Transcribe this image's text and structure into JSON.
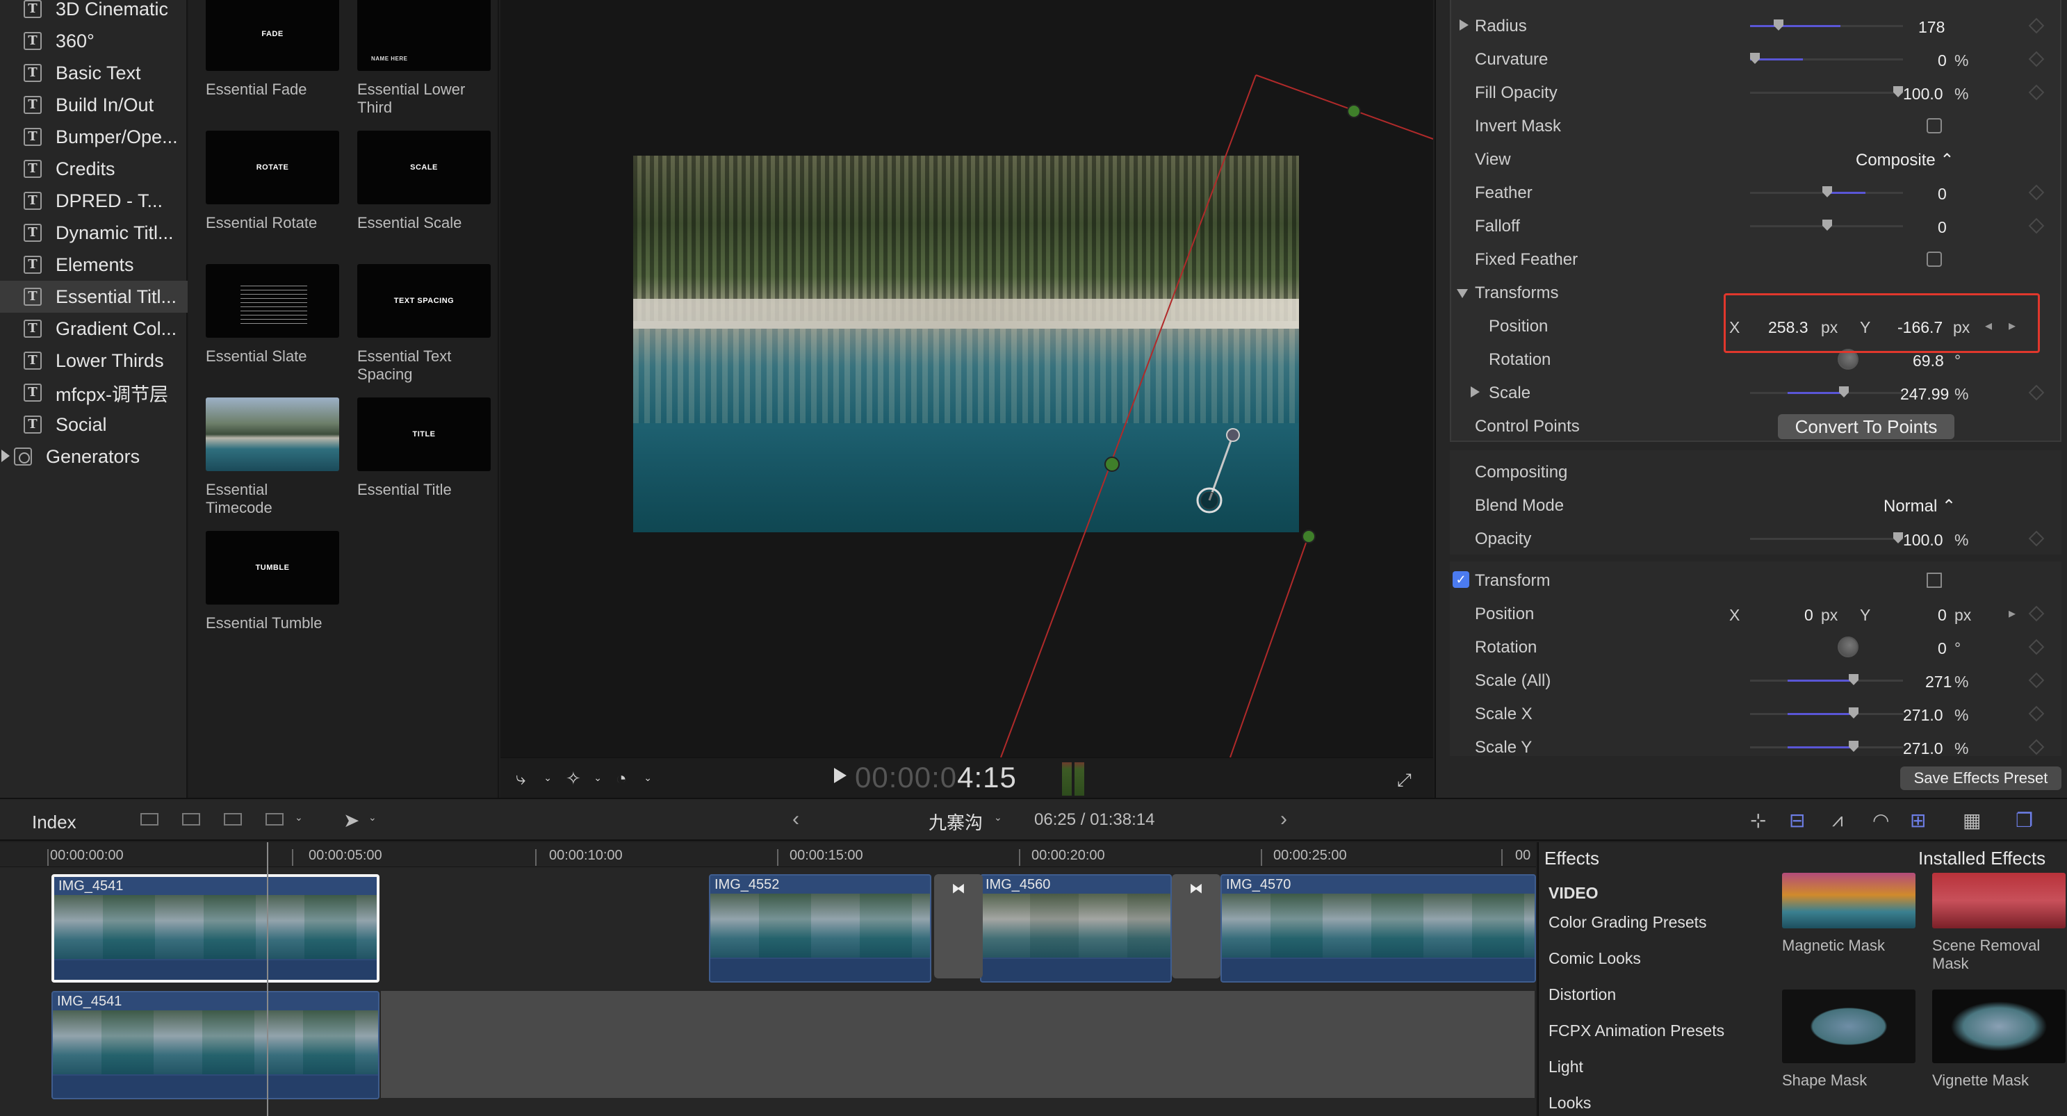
{
  "sidebar": {
    "items": [
      {
        "label": "3D Cinematic"
      },
      {
        "label": "360°"
      },
      {
        "label": "Basic Text"
      },
      {
        "label": "Build In/Out"
      },
      {
        "label": "Bumper/Ope..."
      },
      {
        "label": "Credits"
      },
      {
        "label": "DPRED - T..."
      },
      {
        "label": "Dynamic Titl..."
      },
      {
        "label": "Elements"
      },
      {
        "label": "Essential Titl..."
      },
      {
        "label": "Gradient Col..."
      },
      {
        "label": "Lower Thirds"
      },
      {
        "label": "mfcpx-调节层"
      },
      {
        "label": "Social"
      }
    ],
    "generators_label": "Generators",
    "selected_index": 9
  },
  "browser": {
    "items": [
      {
        "label": "Essential Fade",
        "thumb_text": "FADE"
      },
      {
        "label": "Essential Lower Third",
        "thumb_text": "NAME HERE"
      },
      {
        "label": "Essential Rotate",
        "thumb_text": "ROTATE"
      },
      {
        "label": "Essential Scale",
        "thumb_text": "SCALE"
      },
      {
        "label": "Essential Slate",
        "thumb_text": ""
      },
      {
        "label": "Essential Text Spacing",
        "thumb_text": "TEXT SPACING"
      },
      {
        "label": "Essential Timecode",
        "thumb_text": ""
      },
      {
        "label": "Essential Title",
        "thumb_text": "TITLE"
      },
      {
        "label": "Essential Tumble",
        "thumb_text": "TUMBLE"
      }
    ]
  },
  "viewer": {
    "timecode_dim": "00:00:0",
    "timecode_lit": "4:15"
  },
  "inspector": {
    "radius": {
      "label": "Radius",
      "value": "178"
    },
    "curvature": {
      "label": "Curvature",
      "value": "0",
      "unit": "%"
    },
    "fill_opacity": {
      "label": "Fill Opacity",
      "value": "100.0",
      "unit": "%"
    },
    "invert_mask": {
      "label": "Invert Mask"
    },
    "view": {
      "label": "View",
      "value": "Composite"
    },
    "feather": {
      "label": "Feather",
      "value": "0"
    },
    "falloff": {
      "label": "Falloff",
      "value": "0"
    },
    "fixed_feather": {
      "label": "Fixed Feather"
    },
    "transforms": {
      "label": "Transforms"
    },
    "mask_position": {
      "label": "Position",
      "x_label": "X",
      "x": "258.3",
      "x_unit": "px",
      "y_label": "Y",
      "y": "-166.7",
      "y_unit": "px"
    },
    "mask_rotation": {
      "label": "Rotation",
      "value": "69.8",
      "unit": "°"
    },
    "mask_scale": {
      "label": "Scale",
      "value": "247.99",
      "unit": "%"
    },
    "control_points": {
      "label": "Control Points",
      "button": "Convert To Points"
    },
    "compositing": {
      "label": "Compositing"
    },
    "blend_mode": {
      "label": "Blend Mode",
      "value": "Normal"
    },
    "opacity": {
      "label": "Opacity",
      "value": "100.0",
      "unit": "%"
    },
    "transform": {
      "label": "Transform"
    },
    "position": {
      "label": "Position",
      "x_label": "X",
      "x": "0",
      "x_unit": "px",
      "y_label": "Y",
      "y": "0",
      "y_unit": "px"
    },
    "rotation": {
      "label": "Rotation",
      "value": "0",
      "unit": "°"
    },
    "scale_all": {
      "label": "Scale (All)",
      "value": "271",
      "unit": "%"
    },
    "scale_x": {
      "label": "Scale X",
      "value": "271.0",
      "unit": "%"
    },
    "scale_y": {
      "label": "Scale Y",
      "value": "271.0",
      "unit": "%"
    },
    "save_preset": "Save Effects Preset"
  },
  "timeline_toolbar": {
    "index": "Index",
    "project_name": "九寨沟",
    "project_time": "06:25 / 01:38:14"
  },
  "timeline": {
    "ruler": [
      "00:00:00:00",
      "00:00:05:00",
      "00:00:10:00",
      "00:00:15:00",
      "00:00:20:00",
      "00:00:25:00",
      "00"
    ],
    "clips": [
      {
        "name": "IMG_4541"
      },
      {
        "name": "IMG_4552"
      },
      {
        "name": "IMG_4560"
      },
      {
        "name": "IMG_4570"
      },
      {
        "name": "IMG_4541"
      }
    ]
  },
  "effects": {
    "title": "Effects",
    "installed": "Installed Effects",
    "categories": [
      {
        "label": "VIDEO"
      },
      {
        "label": "Color Grading Presets"
      },
      {
        "label": "Comic Looks"
      },
      {
        "label": "Distortion"
      },
      {
        "label": "FCPX Animation Presets"
      },
      {
        "label": "Light"
      },
      {
        "label": "Looks"
      }
    ],
    "items": [
      {
        "label": "Magnetic Mask"
      },
      {
        "label": "Scene Removal Mask"
      },
      {
        "label": "Shape Mask"
      },
      {
        "label": "Vignette Mask"
      }
    ]
  }
}
